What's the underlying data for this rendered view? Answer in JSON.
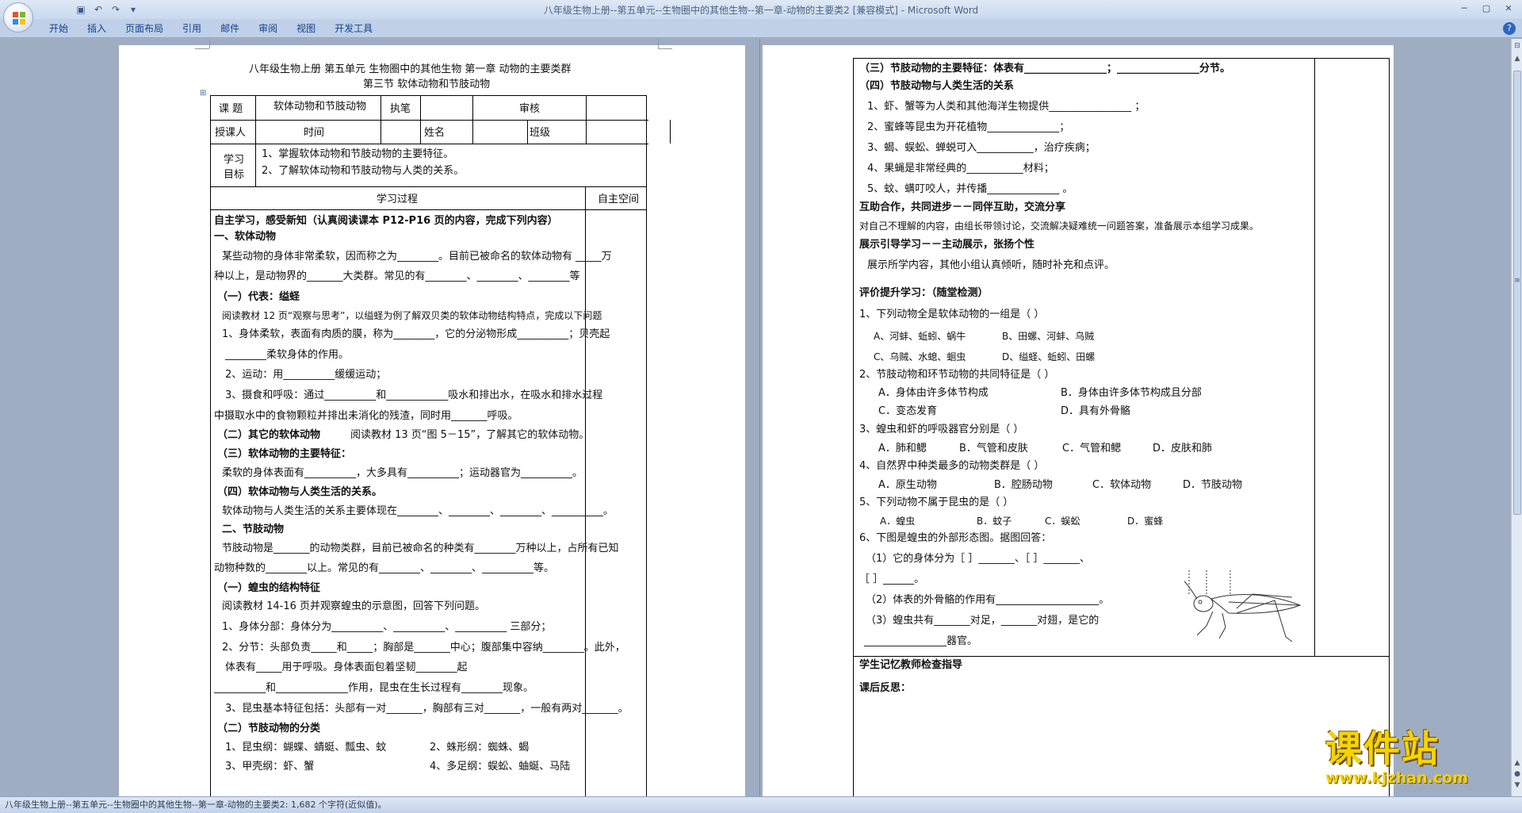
{
  "window": {
    "title": "八年级生物上册--第五单元--生物圈中的其他生物--第一章-动物的主要类2 [兼容模式] - Microsoft Word",
    "controls": [
      "minimize",
      "maximize",
      "close"
    ]
  },
  "quick_access": [
    "save-icon",
    "undo-icon",
    "redo-icon",
    "customize-icon"
  ],
  "ribbon": {
    "tabs": [
      "开始",
      "插入",
      "页面布局",
      "引用",
      "邮件",
      "审阅",
      "视图",
      "开发工具"
    ],
    "help": "?"
  },
  "status_bar": {
    "text": "八年级生物上册--第五单元--生物圈中的其他生物--第一章-动物的主要类2: 1,682 个字符(近似值)。"
  },
  "watermark": {
    "main": "课件站",
    "url": "www.kjzhan.com"
  },
  "page1": {
    "title": "八年级生物上册   第五单元   生物圈中的其他生物   第一章  动物的主要类群",
    "subtitle": "第三节   软体动物和节肢动物",
    "table": {
      "r1": [
        "课   题",
        "软体动物和节肢动物",
        "执笔",
        "审核"
      ],
      "r2": [
        "授课人",
        "时间",
        "姓名",
        "班级"
      ],
      "goal_label_1": "学习",
      "goal_label_2": "目标",
      "goals": [
        "1、掌握软体动物和节肢动物的主要特征。",
        "2、了解软体动物和节肢动物与人类的关系。"
      ],
      "process_header": "学习过程",
      "space_header": "自主空间"
    },
    "lines": [
      "自主学习，感受新知（认真阅读课本 P12-P16 页的内容，完成下列内容）",
      "一、软体动物",
      "某些动物的身体非常柔软，因而称之为________。目前已被命名的软体动物有 _____万",
      "种以上，是动物界的_______大类群。常见的有________、________、________等",
      "（一）代表：缢蛏",
      "阅读教材 12 页“观察与思考”，以缢蛏为例了解双贝类的软体动物结构特点，完成以下问题",
      "1、身体柔软，表面有肉质的膜，称为________，它的分泌物形成__________；贝壳起",
      "________柔软身体的作用。",
      "2、运动：用__________缓缓运动；",
      "3、摄食和呼吸：通过__________和____________吸水和排出水，在吸水和排水过程",
      "中摄取水中的食物颗粒并排出未消化的残渣，同时用_______呼吸。",
      "（二）其它的软体动物",
      "阅读教材 13 页“图 5－15”，了解其它的软体动物。",
      "（三）软体动物的主要特征：",
      "柔软的身体表面有__________，大多具有__________；运动器官为__________。",
      "（四）软体动物与人类生活的关系。",
      "软体动物与人类生活的关系主要体现在________、________、________、__________。",
      "二、节肢动物",
      "节肢动物是_______的动物类群，目前已被命名的种类有________万种以上，占所有已知",
      "动物种数的________以上。常见的有________、________、__________等。",
      "（一）蝗虫的结构特征",
      "阅读教材 14-16 页并观察蝗虫的示意图，回答下列问题。",
      "1、身体分部：身体分为__________、__________、__________ 三部分；",
      "2、分节：头部负责_____和_____；胸部是_______中心；腹部集中容纳________。此外，",
      "体表有_____用于呼吸。身体表面包着坚韧________起",
      "__________和______________作用，昆虫在生长过程有________现象。",
      "3、昆虫基本特征包括：头部有一对_______，胸部有三对_______，一般有两对_______。",
      "（二）节肢动物的分类",
      "1、昆虫纲：蝴蝶、蜻蜓、瓢虫、蚊",
      "2、蛛形纲：蜘蛛、蝎",
      "3、甲壳纲：虾、蟹",
      "4、多足纲：蜈蚣、蚰蜒、马陆"
    ]
  },
  "page2": {
    "lines": [
      "（三）节肢动物的主要特征：体表有________________；________________分节。",
      "（四）节肢动物与人类生活的关系",
      "1、虾、蟹等为人类和其他海洋生物提供________________ ；",
      "2、蜜蜂等昆虫为开花植物______________；",
      "3、蝎、蜈蚣、蝉蜕可入___________，治疗疾病；",
      "4、果蝇是非常经典的___________材料；",
      "5、蚊、螨叮咬人，并传播______________ 。",
      "互助合作，共同进步－－同伴互助，交流分享",
      "对自己不理解的内容，由组长带领讨论，交流解决疑难统一问题答案，准备展示本组学习成果。",
      "展示引导学习－－主动展示，张扬个性",
      "展示所学内容，其他小组认真倾听，随时补充和点评。",
      "评价提升学习：（随堂检测）",
      "1、下列动物全是软体动物的一组是（       ）",
      "A、河蚌、蚯蚓、蜗牛",
      "B、田螺、河蚌、乌贼",
      "C、乌贼、水螅、蛔虫",
      "D、缢蛏、蚯蚓、田螺",
      "2、节肢动物和环节动物的共同特征是（       ）",
      "A．身体由许多体节构成",
      "B．身体由许多体节构成且分部",
      "C．变态发育",
      "D．具有外骨骼",
      "3、蝗虫和虾的呼吸器官分别是（       ）",
      "A．肺和鳃",
      "B．气管和皮肤",
      "C．气管和鳃",
      "D．皮肤和肺",
      "4、自然界中种类最多的动物类群是（       ）",
      "A．原生动物",
      "B．腔肠动物",
      "C．软体动物",
      "D．节肢动物",
      "5、下列动物不属于昆虫的是（      ）",
      "A．蝗虫",
      "B．蚊子",
      "C．蜈蚣",
      "D．蜜蜂",
      "6、下图是蝗虫的外部形态图。据图回答：",
      "（1）它的身体分为［      ］_______、［      ］_______、",
      "［      ］______。",
      "（2）体表的外骨骼的作用有____________________。",
      "（3）蝗虫共有_______对足，_______对翅，是它的",
      "________________器官。",
      "学生记忆教师检查指导",
      "课后反思："
    ]
  }
}
